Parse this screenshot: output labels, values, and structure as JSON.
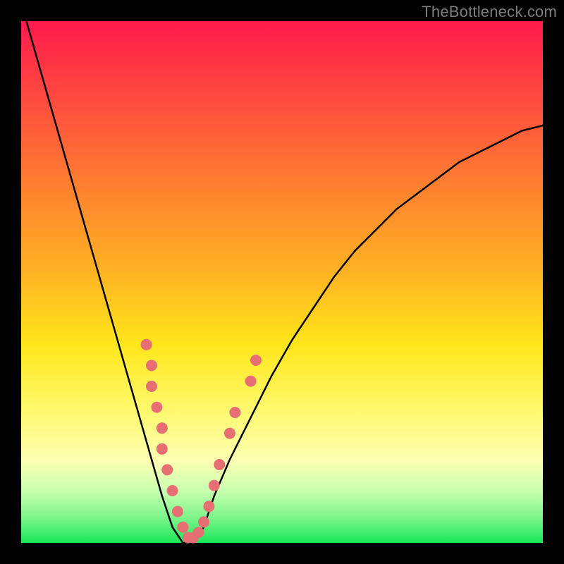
{
  "watermark": "TheBottleneck.com",
  "chart_data": {
    "type": "line",
    "title": "",
    "xlabel": "",
    "ylabel": "",
    "xlim": [
      0,
      100
    ],
    "ylim": [
      0,
      100
    ],
    "grid": false,
    "series": [
      {
        "name": "bottleneck-v-curve",
        "x": [
          1,
          3,
          5,
          7,
          9,
          11,
          13,
          15,
          17,
          19,
          21,
          23,
          25,
          27,
          29,
          31,
          33,
          35,
          37,
          40,
          44,
          48,
          52,
          56,
          60,
          64,
          68,
          72,
          76,
          80,
          84,
          88,
          92,
          96,
          100
        ],
        "values": [
          100,
          93,
          86,
          79,
          72,
          65,
          58,
          51,
          44,
          37,
          30,
          23,
          16,
          9,
          3,
          0,
          0,
          3,
          9,
          16,
          24,
          32,
          39,
          45,
          51,
          56,
          60,
          64,
          67,
          70,
          73,
          75,
          77,
          79,
          80
        ]
      }
    ],
    "markers": {
      "name": "highlight-dots",
      "color": "#e76e72",
      "points": [
        {
          "x": 24,
          "y": 38
        },
        {
          "x": 25,
          "y": 34
        },
        {
          "x": 25,
          "y": 30
        },
        {
          "x": 26,
          "y": 26
        },
        {
          "x": 27,
          "y": 22
        },
        {
          "x": 27,
          "y": 18
        },
        {
          "x": 28,
          "y": 14
        },
        {
          "x": 29,
          "y": 10
        },
        {
          "x": 30,
          "y": 6
        },
        {
          "x": 31,
          "y": 3
        },
        {
          "x": 32,
          "y": 1
        },
        {
          "x": 33,
          "y": 1
        },
        {
          "x": 34,
          "y": 2
        },
        {
          "x": 35,
          "y": 4
        },
        {
          "x": 36,
          "y": 7
        },
        {
          "x": 37,
          "y": 11
        },
        {
          "x": 38,
          "y": 15
        },
        {
          "x": 40,
          "y": 21
        },
        {
          "x": 41,
          "y": 25
        },
        {
          "x": 44,
          "y": 31
        },
        {
          "x": 45,
          "y": 35
        }
      ]
    },
    "background_gradient": {
      "top": "#ff1a4d",
      "mid": "#ffe61a",
      "bottom": "#18e858"
    }
  }
}
